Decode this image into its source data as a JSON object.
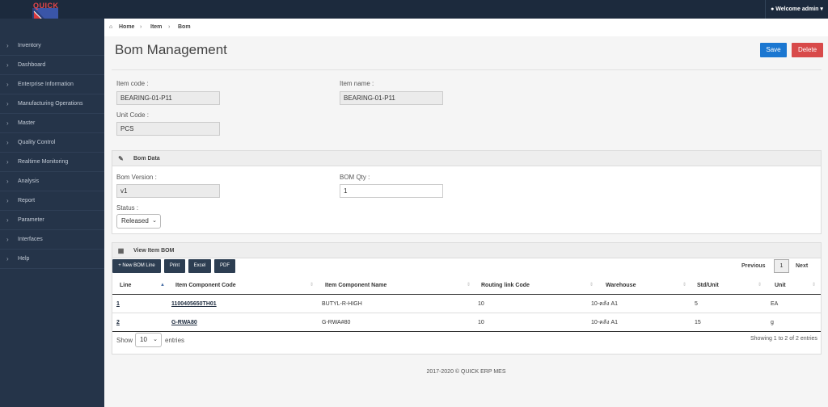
{
  "app": {
    "logo_text": "QUICK"
  },
  "topbar": {
    "welcome": "Welcome admin"
  },
  "sidebar": {
    "items": [
      {
        "label": "Inventory"
      },
      {
        "label": "Dashboard"
      },
      {
        "label": "Enterprise Information"
      },
      {
        "label": "Manufacturing Operations"
      },
      {
        "label": "Master"
      },
      {
        "label": "Quality Control"
      },
      {
        "label": "Realtime Monitoring"
      },
      {
        "label": "Analysis"
      },
      {
        "label": "Report"
      },
      {
        "label": "Parameter"
      },
      {
        "label": "Interfaces"
      },
      {
        "label": "Help"
      }
    ]
  },
  "breadcrumb": {
    "home": "Home",
    "item": "Item",
    "bom": "Bom"
  },
  "page": {
    "title": "Bom Management",
    "save": "Save",
    "delete": "Delete"
  },
  "item": {
    "code_label": "Item code :",
    "code_value": "BEARING-01-P11",
    "name_label": "Item name :",
    "name_value": "BEARING-01-P11",
    "unit_label": "Unit Code :",
    "unit_value": "PCS"
  },
  "bom_data": {
    "title": "Bom Data",
    "version_label": "Bom Version :",
    "version_value": "v1",
    "qty_label": "BOM Qty :",
    "qty_value": "1",
    "status_label": "Status :",
    "status_value": "Released"
  },
  "view_bom": {
    "title": "View Item BOM",
    "buttons": {
      "new": "+ New BOM Line",
      "print": "Print",
      "excel": "Excel",
      "pdf": "PDF"
    },
    "pagination": {
      "previous": "Previous",
      "current": "1",
      "next": "Next"
    },
    "columns": [
      "Line",
      "Item Component Code",
      "Item Component Name",
      "Routing link Code",
      "Warehouse",
      "Std/Unit",
      "Unit"
    ],
    "rows": [
      {
        "line": "1",
        "code": "1100405650TH01",
        "name": "BUTYL-R-HIGH",
        "routing": "10",
        "warehouse": "10-คลัง A1",
        "std": "5",
        "unit": "EA"
      },
      {
        "line": "2",
        "code": "G-RWA80",
        "name": "G-RWA#80",
        "routing": "10",
        "warehouse": "10-คลัง A1",
        "std": "15",
        "unit": "g"
      }
    ],
    "show_label": "Show",
    "show_value": "10",
    "entries_label": "entries",
    "showing": "Showing 1 to 2 of 2 entries"
  },
  "footer": {
    "text": "2017-2020 © QUICK ERP MES"
  }
}
